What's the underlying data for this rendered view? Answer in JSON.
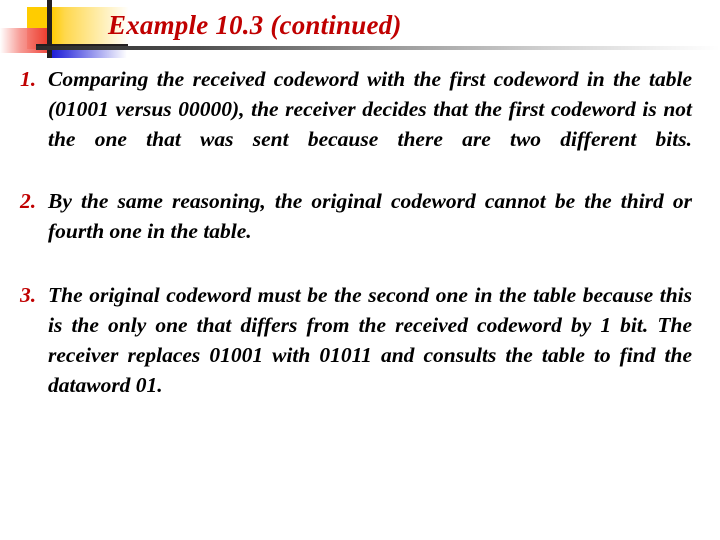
{
  "slide": {
    "title": "Example 10.3 (continued)",
    "title_color": "#c00000",
    "background_color": "#ffffff",
    "body_text_color": "#000000",
    "ornament_colors": {
      "yellow": "#ffcc00",
      "red": "#ea3323",
      "blue": "#1b1bd6",
      "bar": "#231f20"
    }
  },
  "items": [
    {
      "marker": "1.",
      "text": "Comparing the received codeword with the first codeword in the table (01001 versus 00000), the receiver decides that the first codeword is not the one that was sent because there are two different bits."
    },
    {
      "marker": "2.",
      "text": "By the same reasoning, the original codeword cannot be the third or fourth one in the table."
    },
    {
      "marker": "3.",
      "text": "The original codeword must be the second one in the table because this is the only one that differs from the received codeword by 1 bit. The receiver replaces 01001 with 01011 and consults the table to find the dataword 01."
    }
  ]
}
